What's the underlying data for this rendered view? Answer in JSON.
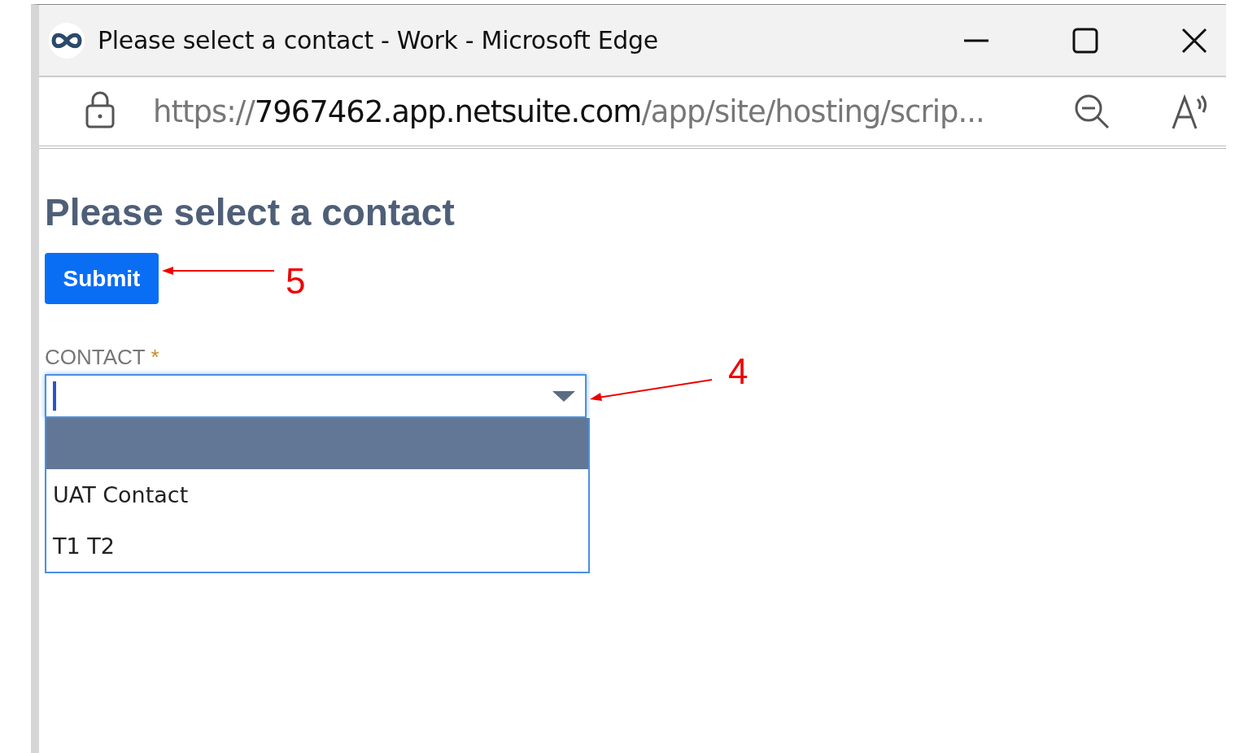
{
  "window": {
    "title": "Please select a contact - Work - Microsoft Edge"
  },
  "address_bar": {
    "scheme": "https://",
    "host": "7967462.app.netsuite.com",
    "path": "/app/site/hosting/scrip..."
  },
  "page": {
    "heading": "Please select a contact",
    "submit_button": "Submit"
  },
  "field": {
    "label": "CONTACT",
    "required_mark": "*",
    "expanded": true,
    "options": [
      {
        "selected": true
      },
      {
        "label": "UAT Contact",
        "selected": false
      },
      {
        "label": "T1 T2",
        "selected": false
      }
    ]
  },
  "annotations": [
    {
      "label": "5"
    },
    {
      "label": "4"
    }
  ]
}
